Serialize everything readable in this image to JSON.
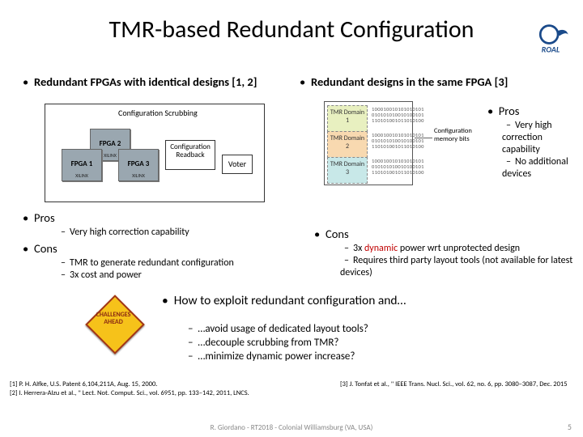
{
  "title": "TMR-based Redundant Configuration",
  "logo_text": "ROAL",
  "heading_left": "Redundant FPGAs with identical designs [1, 2]",
  "heading_right": "Redundant designs in the same FPGA [3]",
  "diagram_left": {
    "scrubbing": "Configuration Scrubbing",
    "fpga1": "FPGA 1",
    "fpga2": "FPGA 2",
    "fpga3": "FPGA 3",
    "xilinx": "XILINX",
    "readback": "Configuration Readback",
    "voter": "Voter"
  },
  "diagram_right": {
    "d1": "TMR Domain 1",
    "d2": "TMR Domain 2",
    "d3": "TMR Domain 3",
    "bits": "100010010101010101\n010101010010100101\n110101001011010100",
    "cfgmem": "Configuration memory bits"
  },
  "pros_right": {
    "title": "Pros",
    "i1": "Very high correction capability",
    "i2": "No additional devices"
  },
  "left_pros": {
    "title": "Pros",
    "i1": "Very high correction capability"
  },
  "left_cons": {
    "title": "Cons",
    "i1": "TMR to generate redundant configuration",
    "i2": "3x cost and power"
  },
  "right_cons": {
    "title": "Cons",
    "i2": "Requires third party layout tools (not available for latest devices)"
  },
  "challenges_sign": "CHALLENGES AHEAD",
  "howto": {
    "lead": "How to exploit redundant configuration and…",
    "q1": "…avoid usage of dedicated layout tools?",
    "q2": "…decouple scrubbing from TMR?",
    "q3": "…minimize dynamic power increase?"
  },
  "refs": {
    "r1": "[1] P. H. Alfke, U.S. Patent 6,104,211A, Aug. 15, 2000.",
    "r2": "[2] I. Herrera-Alzu et al., \" Lect. Not. Comput. Sci., vol. 6951, pp. 133–142, 2011, LNCS.",
    "r3": "[3] J. Tonfat et al., \" IEEE Trans. Nucl. Sci., vol. 62, no. 6, pp. 3080–3087, Dec. 2015"
  },
  "footer": "R. Giordano - RT2018 - Colonial Williamsburg (VA, USA)",
  "pagenum": "5"
}
